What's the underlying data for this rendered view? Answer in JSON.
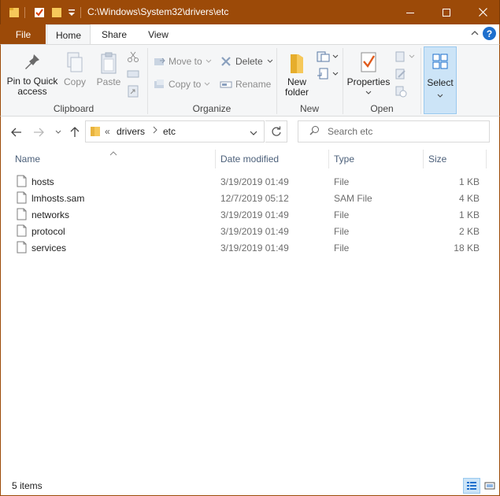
{
  "window": {
    "title": "C:\\Windows\\System32\\drivers\\etc",
    "accent": "#9c4a08"
  },
  "ribbon_tabs": {
    "file": "File",
    "home": "Home",
    "share": "Share",
    "view": "View"
  },
  "ribbon": {
    "clipboard": {
      "label": "Clipboard",
      "pin_line1": "Pin to Quick",
      "pin_line2": "access",
      "copy": "Copy",
      "paste": "Paste"
    },
    "organize": {
      "label": "Organize",
      "move_to": "Move to",
      "copy_to": "Copy to",
      "delete": "Delete",
      "rename": "Rename"
    },
    "new": {
      "label": "New",
      "new_folder_line1": "New",
      "new_folder_line2": "folder"
    },
    "open": {
      "label": "Open",
      "properties": "Properties"
    },
    "select": {
      "label": "Select"
    }
  },
  "address": {
    "overflow": "«",
    "crumbs": [
      "drivers",
      "etc"
    ],
    "search_placeholder": "Search etc"
  },
  "columns": {
    "name": "Name",
    "date": "Date modified",
    "type": "Type",
    "size": "Size"
  },
  "files": [
    {
      "name": "hosts",
      "date": "3/19/2019 01:49",
      "type": "File",
      "size": "1 KB"
    },
    {
      "name": "lmhosts.sam",
      "date": "12/7/2019 05:12",
      "type": "SAM File",
      "size": "4 KB"
    },
    {
      "name": "networks",
      "date": "3/19/2019 01:49",
      "type": "File",
      "size": "1 KB"
    },
    {
      "name": "protocol",
      "date": "3/19/2019 01:49",
      "type": "File",
      "size": "2 KB"
    },
    {
      "name": "services",
      "date": "3/19/2019 01:49",
      "type": "File",
      "size": "18 KB"
    }
  ],
  "status": {
    "item_count": "5 items"
  }
}
